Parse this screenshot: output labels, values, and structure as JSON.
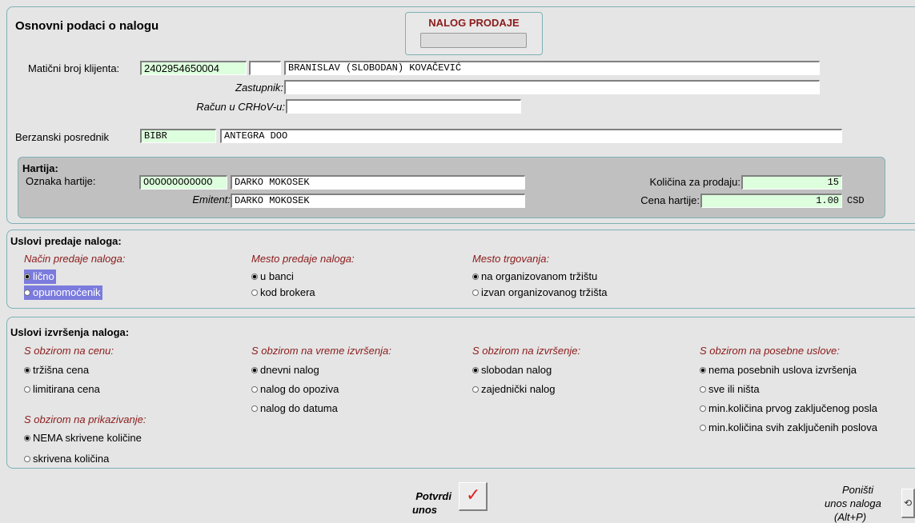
{
  "basic": {
    "title": "Osnovni podaci o nalogu",
    "order_type": "NALOG PRODAJE",
    "client_id_label": "Matični broj klijenta:",
    "client_id_value": "2402954650004",
    "client_extra_value": "",
    "client_name_value": "BRANISLAV  (SLOBODAN)  KOVAČEVIĆ",
    "representative_label": "Zastupnik:",
    "representative_value": "",
    "account_label": "Račun u CRHoV-u:",
    "account_value": "",
    "broker_label": "Berzanski posrednik",
    "broker_code": "BIBR",
    "broker_name": "ANTEGRA DOO"
  },
  "security": {
    "header": "Hartija:",
    "code_label": "Oznaka hartije:",
    "code_value": "OOOOOOOOOOOO",
    "code_name": "DARKO  MOKOSEK",
    "issuer_label": "Emitent:",
    "issuer_value": "DARKO  MOKOSEK",
    "quantity_label": "Količina za prodaju:",
    "quantity_value": "15",
    "price_label": "Cena hartije:",
    "price_value": "1.00",
    "currency": "CSD"
  },
  "submission": {
    "header": "Uslovi predaje naloga:",
    "groups": [
      {
        "title": "Način predaje naloga:",
        "options": [
          "lično",
          "opunomoćenik"
        ]
      },
      {
        "title": "Mesto predaje naloga:",
        "options": [
          "u banci",
          "kod brokera"
        ]
      },
      {
        "title": "Mesto trgovanja:",
        "options": [
          "na organizovanom tržištu",
          "izvan organizovanog tržišta"
        ]
      }
    ]
  },
  "execution": {
    "header": "Uslovi izvršenja naloga:",
    "groups": [
      {
        "title": "S obzirom na cenu:",
        "options": [
          "tržišna cena",
          "limitirana cena"
        ]
      },
      {
        "title": "S obzirom na vreme izvršenja:",
        "options": [
          "dnevni nalog",
          "nalog do opoziva",
          "nalog do datuma"
        ]
      },
      {
        "title": "S obzirom na izvršenje:",
        "options": [
          "slobodan nalog",
          "zajednički nalog"
        ]
      },
      {
        "title": "S obzirom na posebne uslove:",
        "options": [
          "nema posebnih uslova izvršenja",
          "sve ili ništa",
          "min.količina prvog zaključenog posla",
          "min.količina svih zaključenih poslova"
        ]
      },
      {
        "title": "S obzirom na prikazivanje:",
        "options": [
          "NEMA skrivene količine",
          "skrivena količina"
        ]
      }
    ]
  },
  "actions": {
    "confirm_line1": "Potvrdi",
    "confirm_line2": "unos",
    "cancel_line1": "Poništi",
    "cancel_line2": "unos naloga",
    "cancel_line3": "(Alt+P)"
  },
  "colors": {
    "background": "#e5e5e5",
    "panel_border": "#7fb1b5",
    "label_red": "#8b1a1a",
    "green_field": "#ddffdd",
    "selection": "#7b7bde"
  }
}
